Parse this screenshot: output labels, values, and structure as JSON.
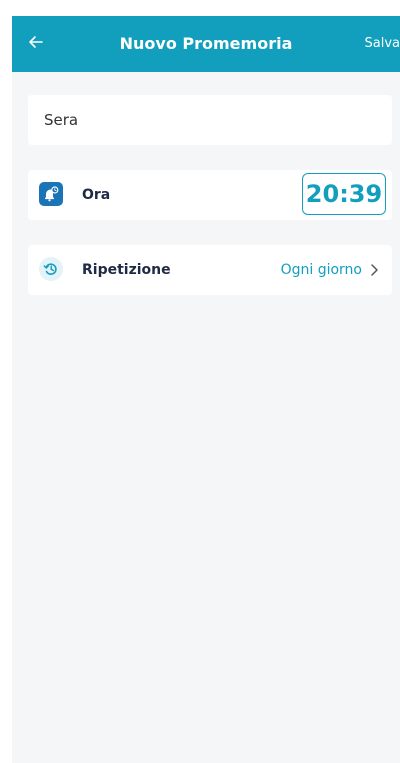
{
  "header": {
    "title": "Nuovo Promemoria",
    "save_label": "Salva",
    "back_icon": "arrow-left-icon"
  },
  "reminder": {
    "name_value": "Sera"
  },
  "time_row": {
    "icon": "alarm-bell-icon",
    "label": "Ora",
    "value": "20:39"
  },
  "repeat_row": {
    "icon": "repeat-history-icon",
    "label": "Ripetizione",
    "value": "Ogni giorno",
    "chevron_icon": "chevron-right-icon"
  },
  "colors": {
    "accent": "#129fbd",
    "header_bg": "#129fbd",
    "bell_icon_bg": "#1b73b8",
    "page_bg": "#f5f6f7"
  }
}
